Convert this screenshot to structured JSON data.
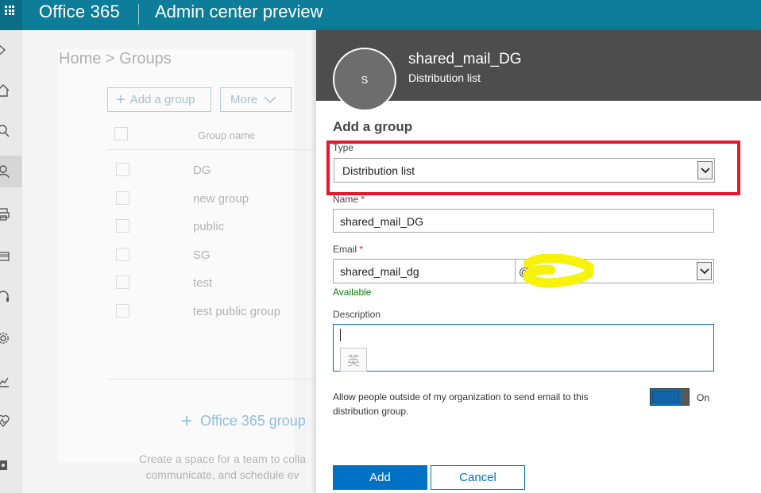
{
  "header": {
    "brand": "Office 365",
    "app_title": "Admin center preview"
  },
  "rail": {
    "icons": [
      "expand-icon",
      "home-icon",
      "search-icon",
      "users-icon",
      "devices-icon",
      "billing-icon",
      "support-icon",
      "settings-icon",
      "reports-icon",
      "health-icon",
      "admin-centers-icon"
    ]
  },
  "background": {
    "breadcrumb": "Home > Groups",
    "add_group_label": "Add a group",
    "more_label": "More",
    "column_group_name": "Group name",
    "groups": [
      "DG",
      "new group",
      "public",
      "SG",
      "test",
      "test public group"
    ],
    "o365_group_label": "Office 365 group",
    "create_text_line1": "Create a space for a team to colla",
    "create_text_line2": "communicate, and schedule ev"
  },
  "panel": {
    "avatar_initial": "S",
    "title": "shared_mail_DG",
    "subtitle": "Distribution list",
    "section_title": "Add a group",
    "type_label": "Type",
    "type_value": "Distribution list",
    "name_label": "Name",
    "name_required": "*",
    "name_value": "shared_mail_DG",
    "email_label": "Email",
    "email_required": "*",
    "email_value": "shared_mail_dg",
    "email_at": "@",
    "email_status": "Available",
    "description_label": "Description",
    "ime_indicator": "英",
    "allow_text": "Allow people outside of my organization to send email to this distribution group.",
    "toggle_state": "On",
    "add_button": "Add",
    "cancel_button": "Cancel"
  },
  "colors": {
    "topbar": "#0d7d99",
    "panel_header": "#4d4d4d",
    "primary": "#0072c6",
    "highlight": "#e8162d",
    "available": "#107c10",
    "scribble": "#f6f20b"
  }
}
